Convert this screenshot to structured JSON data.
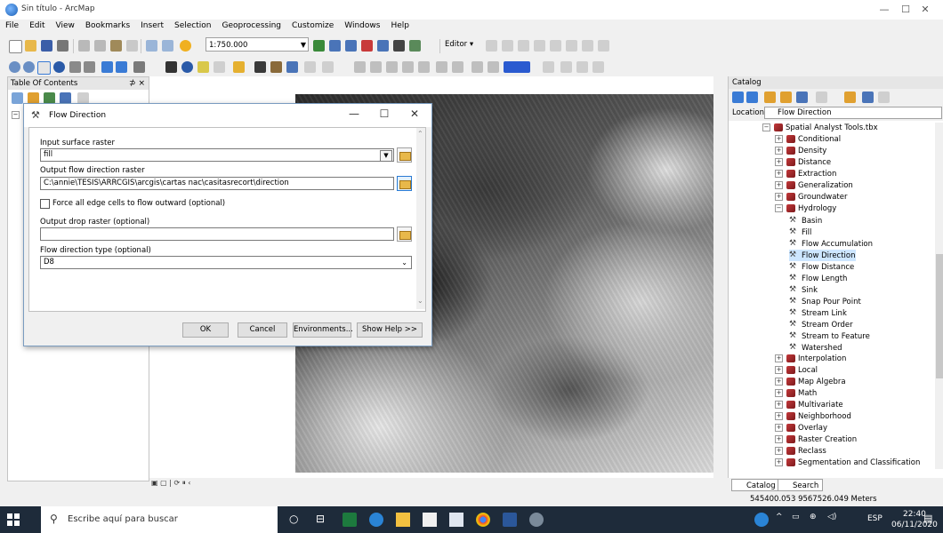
{
  "window": {
    "title": "Sin título - ArcMap",
    "minimize": "—",
    "maximize": "☐",
    "close": "✕"
  },
  "menu": [
    "File",
    "Edit",
    "View",
    "Bookmarks",
    "Insert",
    "Selection",
    "Geoprocessing",
    "Customize",
    "Windows",
    "Help"
  ],
  "toolbar": {
    "scale": "1:750.000",
    "editor_label": "Editor ▾"
  },
  "toc": {
    "title": "Table Of Contents",
    "close": "⊅ ×"
  },
  "dialog": {
    "title": "Flow Direction",
    "input_surface_label": "Input surface raster",
    "input_surface_value": "fill",
    "output_direction_label": "Output flow direction raster",
    "output_direction_value": "C:\\annie\\TESIS\\ARRCGIS\\arcgis\\cartas nac\\casitasrecort\\direction",
    "force_edge_label": "Force all edge cells to flow outward (optional)",
    "output_drop_label": "Output drop raster (optional)",
    "output_drop_value": "",
    "flow_type_label": "Flow direction type (optional)",
    "flow_type_value": "D8",
    "ok": "OK",
    "cancel": "Cancel",
    "environments": "Environments...",
    "show_help": "Show Help >>"
  },
  "catalog": {
    "title": "Catalog",
    "location_label": "Location:",
    "location_value": "Flow Direction",
    "tree": {
      "root": "Spatial Analyst Tools.tbx",
      "toolsets_top": [
        "Conditional",
        "Density",
        "Distance",
        "Extraction",
        "Generalization",
        "Groundwater"
      ],
      "hydrology": "Hydrology",
      "hydrology_tools": [
        "Basin",
        "Fill",
        "Flow Accumulation",
        "Flow Direction",
        "Flow Distance",
        "Flow Length",
        "Sink",
        "Snap Pour Point",
        "Stream Link",
        "Stream Order",
        "Stream to Feature",
        "Watershed"
      ],
      "toolsets_bottom": [
        "Interpolation",
        "Local",
        "Map Algebra",
        "Math",
        "Multivariate",
        "Neighborhood",
        "Overlay",
        "Raster Creation",
        "Reclass",
        "Segmentation and Classification"
      ]
    },
    "tab_catalog": "Catalog",
    "tab_search": "Search"
  },
  "status": {
    "coordinates": "545400.053  9567526.049 Meters"
  },
  "taskbar": {
    "search_placeholder": "Escribe aquí para buscar",
    "lang": "ESP",
    "time": "22:40",
    "date": "06/11/2020"
  },
  "colors": {
    "selected": "#cde6ff",
    "taskbar": "#1e2b3a",
    "accent": "#2a7bd3"
  }
}
